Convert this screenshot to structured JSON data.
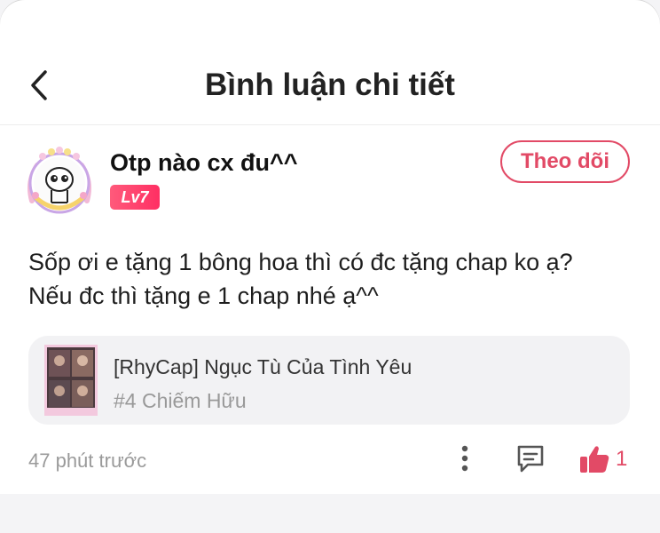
{
  "header": {
    "title": "Bình luận chi tiết",
    "back_icon": "chevron-left-icon"
  },
  "user": {
    "name": "Otp nào cx đu^^",
    "level": "Lv7",
    "follow_label": "Theo dõi"
  },
  "comment": {
    "line1": "Sốp ơi e tặng 1 bông hoa thì có đc tặng chap ko ạ?",
    "line2": "Nếu đc thì tặng e 1 chap nhé ạ^^"
  },
  "story": {
    "title": "[RhyCap] Ngục Tù Của Tình Yêu",
    "chapter": "#4 Chiếm Hữu"
  },
  "footer": {
    "time": "47 phút trước",
    "like_count": "1",
    "like_color": "#e24a66"
  }
}
